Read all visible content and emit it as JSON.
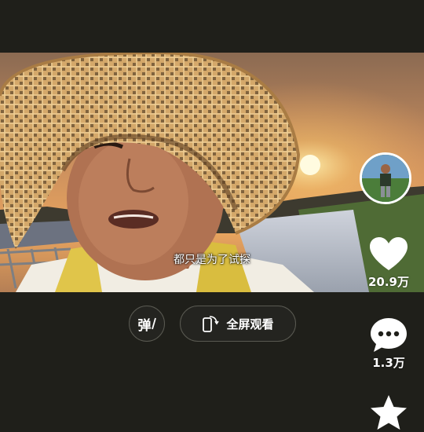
{
  "video": {
    "subtitle": "都只是为了试探"
  },
  "side_actions": {
    "like_count": "20.9万",
    "comment_count": "1.3万"
  },
  "controls": {
    "danmu_label": "弹",
    "fullscreen_label": "全屏观看"
  },
  "colors": {
    "background": "#1f1f1a",
    "icon_white": "#ffffff",
    "button_border": "#5a5a52"
  }
}
